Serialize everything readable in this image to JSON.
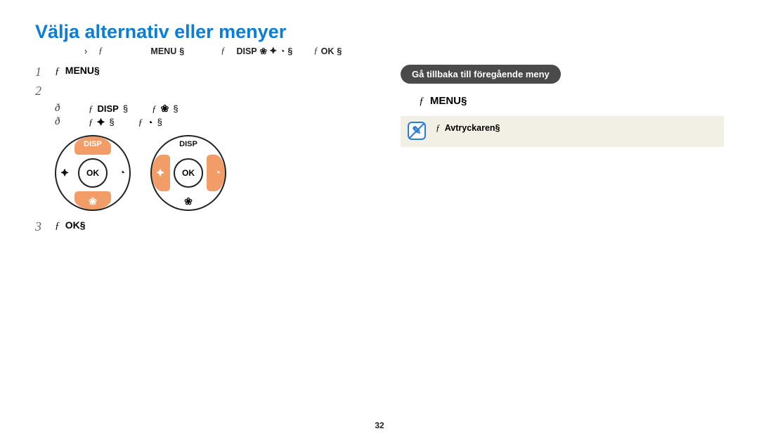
{
  "title": "Välja alternativ eller menyer",
  "intro": {
    "bullet": "›",
    "f1": "ƒ",
    "menu": "MENU",
    "sec1": "§",
    "f2": "ƒ",
    "disp": "DISP",
    "macro": "❀",
    "flash": "⯌",
    "timer": "◔",
    "sec2": "§",
    "f3": "ƒ",
    "ok": "OK",
    "sec3": "§"
  },
  "steps": {
    "s1": {
      "num": "1",
      "f": "ƒ",
      "label": "MENU",
      "sec": "§"
    },
    "s2": {
      "num": "2",
      "line1": {
        "b": "ð",
        "f1": "ƒ",
        "disp": "DISP",
        "sec1": "§",
        "f2": "ƒ",
        "macro": "❀",
        "sec2": "§"
      },
      "line2": {
        "b": "ð",
        "f1": "ƒ",
        "flash": "⯌",
        "sec1": "§",
        "f2": "ƒ",
        "timer": "◔",
        "sec2": "§"
      }
    },
    "s3": {
      "num": "3",
      "f": "ƒ",
      "label": "OK",
      "sec": "§"
    }
  },
  "dial": {
    "ok": "OK",
    "disp": "DISP",
    "macro": "❀",
    "flash": "⯌",
    "timer": "◔"
  },
  "right": {
    "badge": "Gå tillbaka till föregående meny",
    "menu": {
      "f": "ƒ",
      "label": "MENU",
      "sec": "§"
    },
    "note": {
      "f": "ƒ",
      "label": "Avtryckaren",
      "sec": "§"
    }
  },
  "pageNumber": "32"
}
